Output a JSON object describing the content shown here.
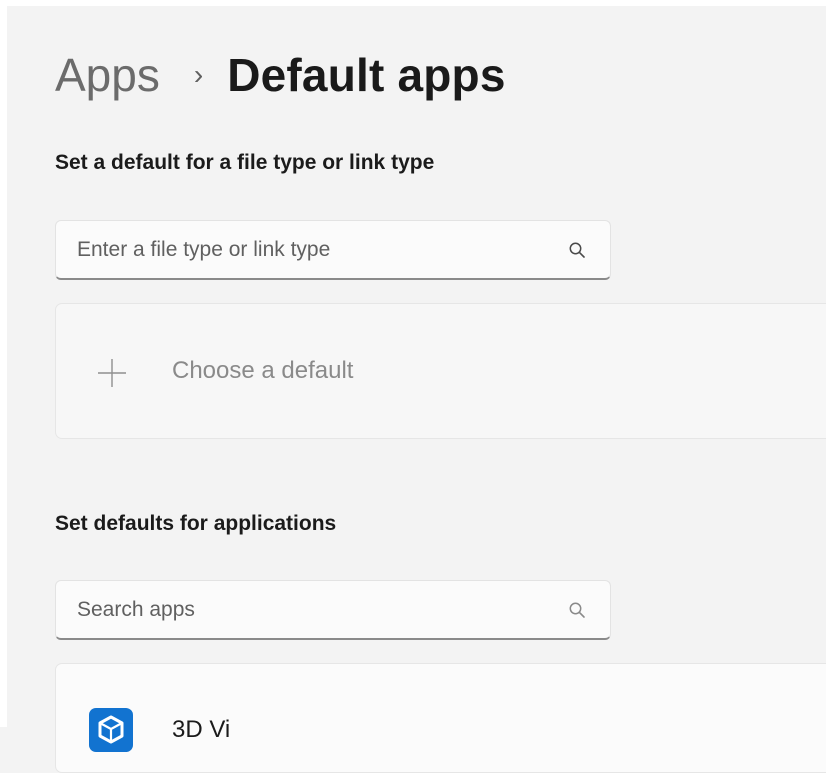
{
  "breadcrumb": {
    "parent": "Apps",
    "separator": "›",
    "current": "Default apps"
  },
  "file_type_section": {
    "title": "Set a default for a file type or link type",
    "search": {
      "placeholder": "Enter a file type or link type",
      "icon": "search-icon"
    },
    "choose": {
      "label": "Choose a default",
      "icon": "plus-icon"
    }
  },
  "apps_section": {
    "title": "Set defaults for applications",
    "search": {
      "placeholder": "Search apps",
      "icon": "search-icon"
    },
    "apps": [
      {
        "name": "3D Vi",
        "icon": "3d-viewer-icon",
        "icon_color": "#1273d0"
      }
    ]
  }
}
